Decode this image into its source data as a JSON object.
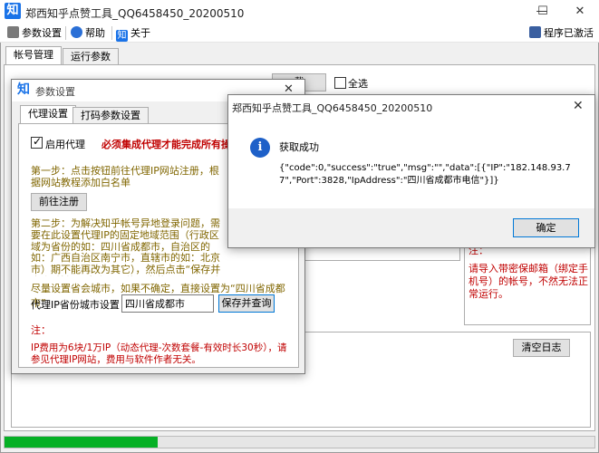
{
  "main_window": {
    "title": "郑西知乎点赞工具_QQ6458450_20200510",
    "logo_char": "知",
    "controls": {
      "min": "—",
      "max": "☐",
      "close": "✕"
    }
  },
  "menu": {
    "settings": "参数设置",
    "help": "帮助",
    "about": "关于",
    "activated": "程序已激活"
  },
  "main_tabs": [
    "帐号管理",
    "运行参数"
  ],
  "main_panel": {
    "select_all": "全选",
    "button_fragment": "载",
    "right_note_prefix": "注：",
    "right_note": "请导入带密保邮箱（绑定手机号）的帐号，不然无法正常运行。",
    "clear_log": "清空日志"
  },
  "progress": {
    "value_percent": 26
  },
  "settings_dialog": {
    "logo_char": "知",
    "title": "参数设置",
    "close": "✕",
    "tabs": [
      "代理设置",
      "打码参数设置"
    ],
    "enable_proxy_label": "启用代理",
    "enable_proxy_checked": true,
    "warning": "必须集成代理才能完成所有操作",
    "step1": "第一步：点击按钮前往代理IP网站注册，根据网站教程添加白名单",
    "goto_register": "前往注册",
    "step2": "第二步：为解决知乎帐号异地登录问题，需要在此设置代理IP的固定地域范围（行政区域为省份的如：四川省成都市，自治区的如：广西自治区南宁市，直辖市的如：北京市）期不能再改为其它），然后点击“保存并查询”按钮，查询是否能正常获取代理IP，如果不正常请联系代理IP网站上客服。",
    "hint": "尽量设置省会城市，如果不确定，直接设置为“四川省成都市”",
    "city_label": "代理IP省份城市设置",
    "city_value": "四川省成都市",
    "save_query": "保存并查询",
    "note_label": "注：",
    "note": "IP费用为6块/1万IP（动态代理-次数套餐-有效时长30秒），请参见代理IP网站，费用与软件作者无关。"
  },
  "message_box": {
    "title": "郑西知乎点赞工具_QQ6458450_20200510",
    "close": "✕",
    "icon_char": "i",
    "heading": "获取成功",
    "body": "{\"code\":0,\"success\":\"true\",\"msg\":\"\",\"data\":[{\"IP\":\"182.148.93.77\",\"Port\":3828,\"IpAddress\":\"四川省成都市电信\"}]}",
    "ok": "确定"
  },
  "colors": {
    "accent": "#0078d7",
    "warning_red": "#c00000",
    "step_olive": "#806600",
    "progress_green": "#06b025"
  }
}
